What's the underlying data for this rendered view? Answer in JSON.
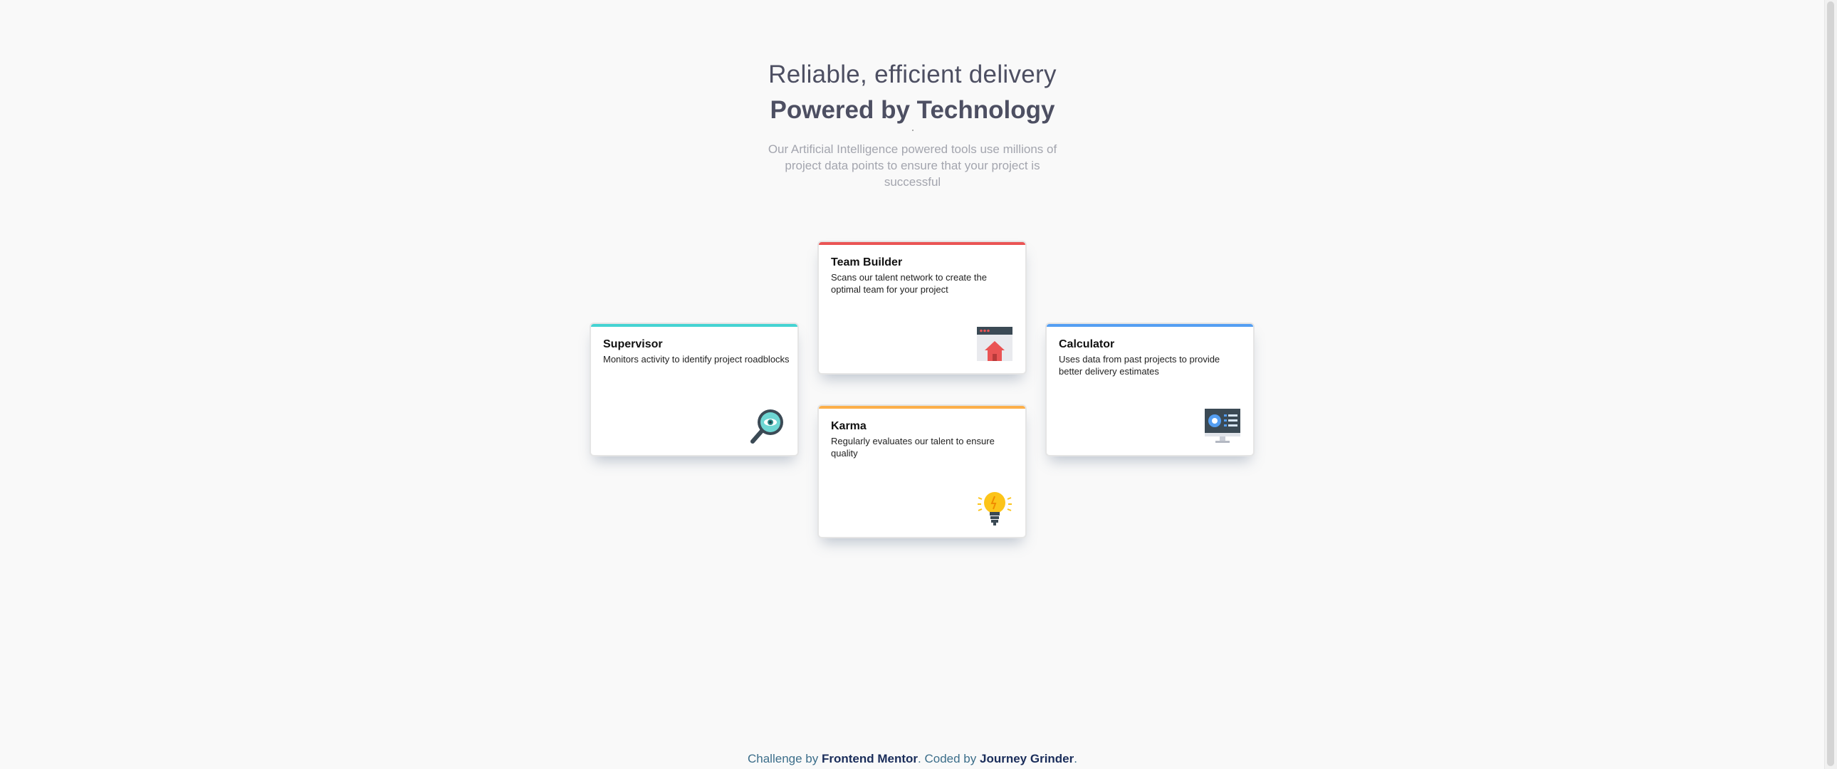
{
  "header": {
    "headline_light": "Reliable, efficient delivery",
    "headline_bold": "Powered by Technology",
    "intro": "Our Artificial Intelligence powered tools use millions of project data points to ensure that your project is successful"
  },
  "cards": {
    "supervisor": {
      "title": "Supervisor",
      "description": "Monitors activity to identify project roadblocks",
      "accent": "#44d3d2",
      "icon": "magnifier-eye-icon"
    },
    "team_builder": {
      "title": "Team Builder",
      "description": "Scans our talent network to create the optimal team for your project",
      "accent": "#ea5454",
      "icon": "browser-home-icon"
    },
    "karma": {
      "title": "Karma",
      "description": "Regularly evaluates our talent to ensure quality",
      "accent": "#fcaf4a",
      "icon": "lightbulb-icon"
    },
    "calculator": {
      "title": "Calculator",
      "description": "Uses data from past projects to provide better delivery estimates",
      "accent": "#549ef2",
      "icon": "monitor-dashboard-icon"
    }
  },
  "footer": {
    "prefix": "Challenge by",
    "challenge_link": "Frontend Mentor",
    "middle": ". Coded by",
    "author_link": "Journey Grinder",
    "suffix": "."
  }
}
